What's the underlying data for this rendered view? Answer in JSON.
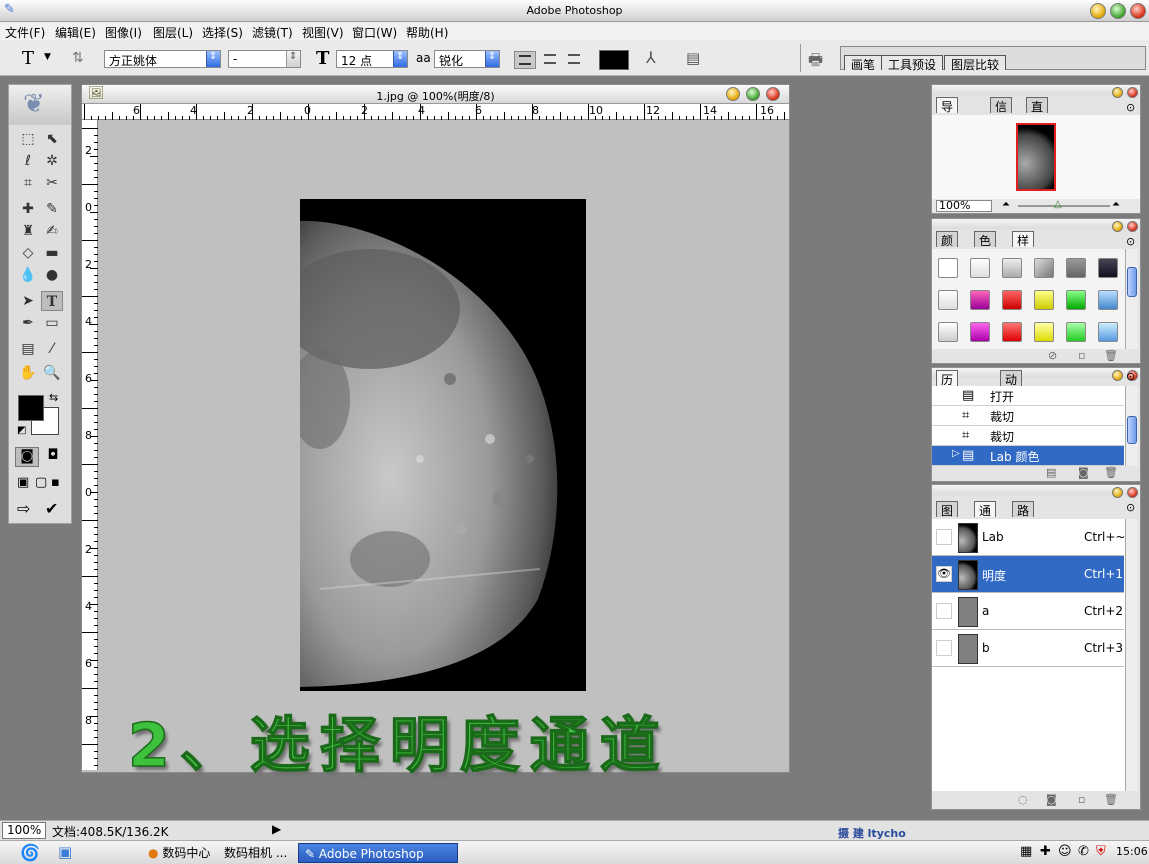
{
  "app": {
    "title": "Adobe Photoshop"
  },
  "menu": [
    "文件(F)",
    "编辑(E)",
    "图像(I)",
    "图层(L)",
    "选择(S)",
    "滤镜(T)",
    "视图(V)",
    "窗口(W)",
    "帮助(H)"
  ],
  "options": {
    "tool_glyph": "T",
    "font_family": "方正姚体",
    "font_style": "-",
    "font_size": "12 点",
    "aa_label": "aa",
    "antialias": "锐化",
    "color": "#000000",
    "right_tabs": [
      "画笔",
      "工具预设",
      "图层比较"
    ]
  },
  "document": {
    "title": "1.jpg @ 100%(明度/8)",
    "ruler_h": [
      "6",
      "4",
      "2",
      "0",
      "2",
      "4",
      "6",
      "8",
      "10",
      "12",
      "14",
      "16"
    ],
    "ruler_v": [
      "2",
      "0",
      "2",
      "4",
      "6",
      "8",
      "0",
      "2",
      "4",
      "6",
      "8"
    ],
    "caption": "2、选择明度通道"
  },
  "navigator": {
    "tabs": [
      "导航器",
      "信息",
      "直方图"
    ],
    "zoom": "100%"
  },
  "styles": {
    "tabs": [
      "颜色",
      "色板",
      "样式"
    ]
  },
  "history": {
    "tabs": [
      "历史记录",
      "动作"
    ],
    "items": [
      "打开",
      "裁切",
      "裁切",
      "Lab 颜色"
    ]
  },
  "channels": {
    "tabs": [
      "图层",
      "通道",
      "路径"
    ],
    "rows": [
      {
        "name": "Lab",
        "shortcut": "Ctrl+~"
      },
      {
        "name": "明度",
        "shortcut": "Ctrl+1"
      },
      {
        "name": "a",
        "shortcut": "Ctrl+2"
      },
      {
        "name": "b",
        "shortcut": "Ctrl+3"
      }
    ]
  },
  "status": {
    "zoom": "100%",
    "doc_info": "文档:408.5K/136.2K"
  },
  "watermark": "摄 建 ltycho",
  "taskbar": {
    "items": [
      "数码中心",
      "数码相机 ...",
      "Adobe Photoshop"
    ],
    "clock": "15:06"
  },
  "colors": {
    "accent": "#316ac5",
    "caption": "#3ec23e"
  }
}
